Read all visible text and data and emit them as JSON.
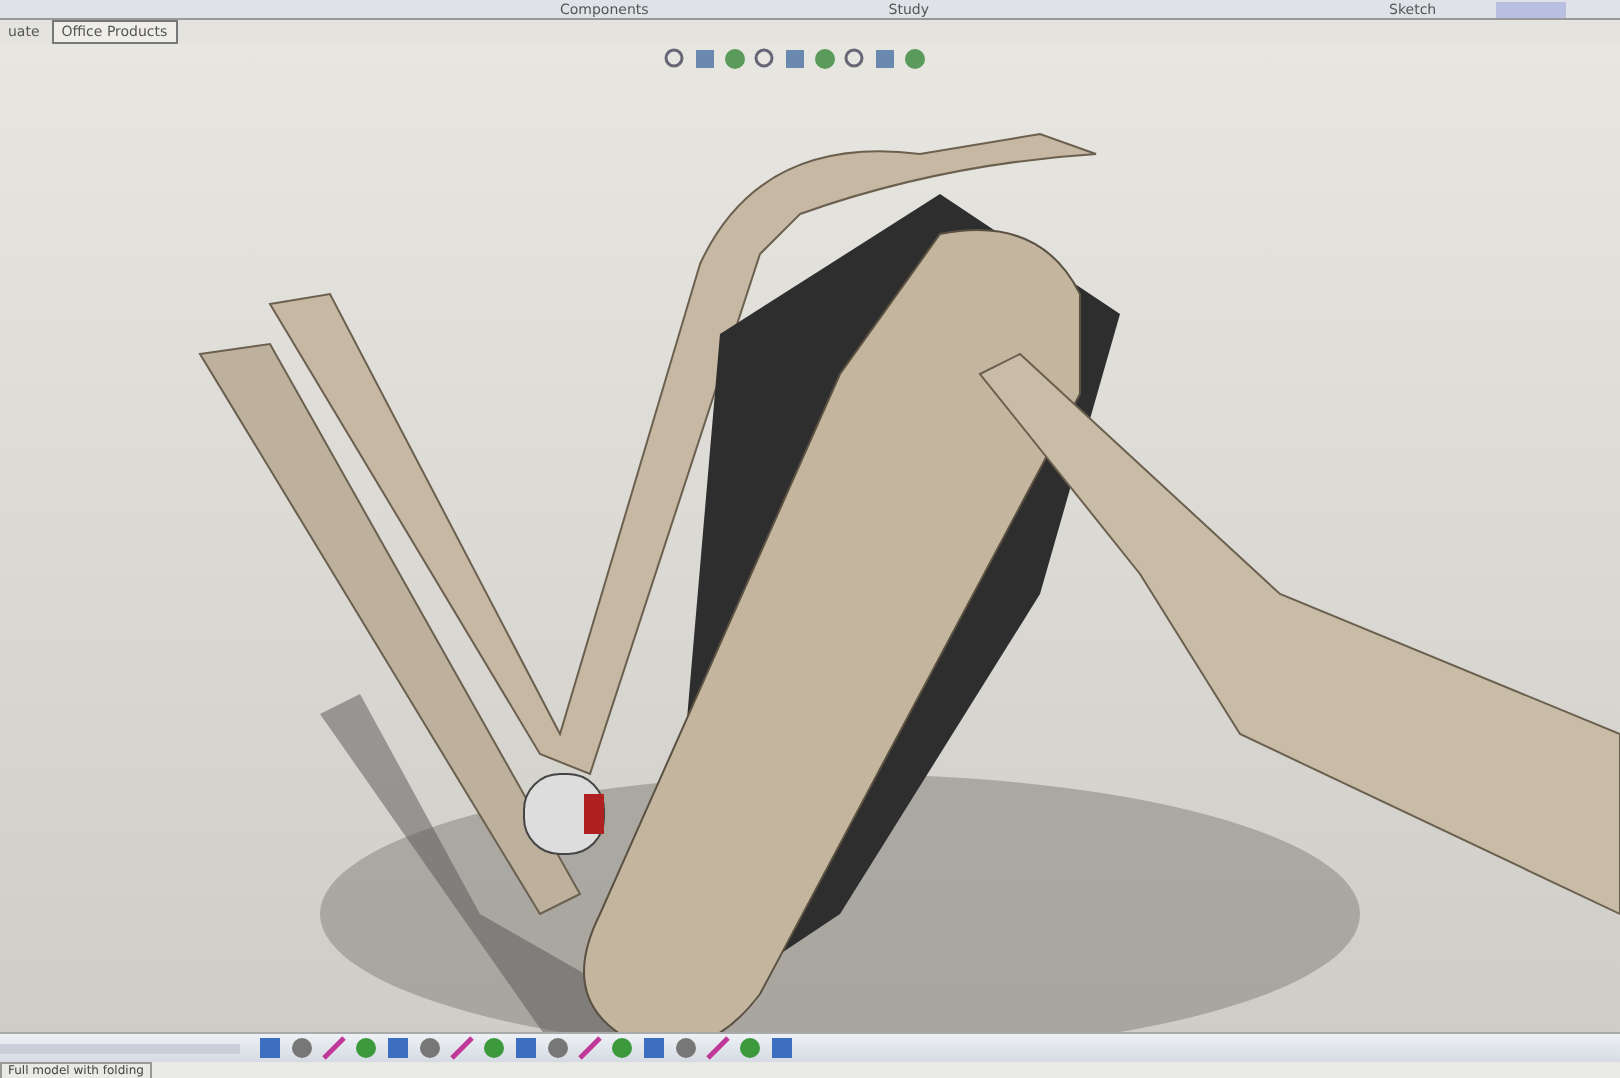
{
  "ribbon": {
    "labels": [
      "Components",
      "Study",
      "Sketch"
    ]
  },
  "tabs": [
    {
      "label": "uate",
      "selected": false
    },
    {
      "label": "Office Products",
      "selected": true
    }
  ],
  "status_bar": {
    "text": "Full model with folding"
  }
}
